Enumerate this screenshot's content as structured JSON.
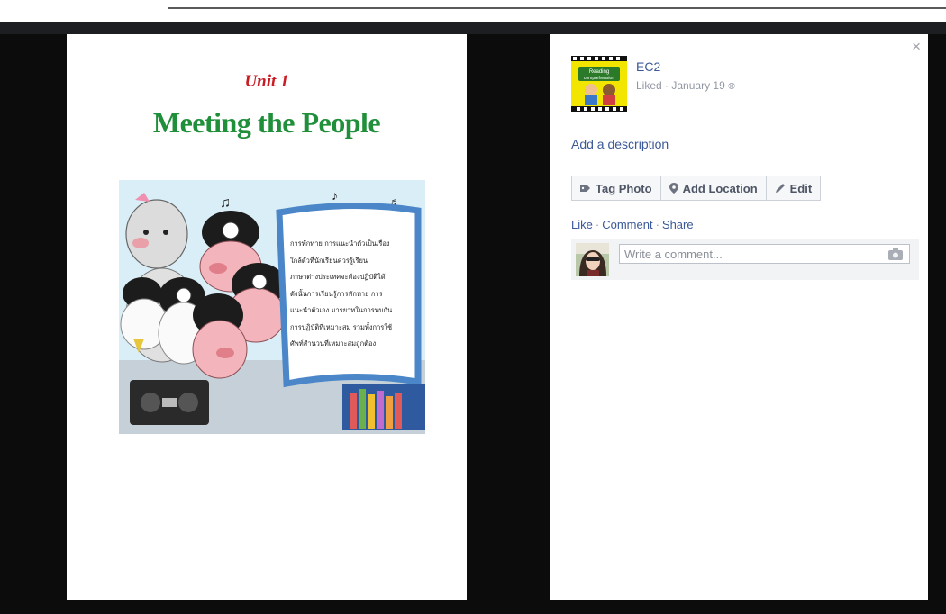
{
  "photo": {
    "unit": "Unit 1",
    "title": "Meeting the People",
    "thai_lines": [
      "การทักทาย การแนะนำตัวเป็นเรื่อง",
      "ใกล้ตัวที่นักเรียนควรรู้เรียน",
      "ภาษาต่างประเทศจะต้องปฏิบัติได้",
      "ดังนั้นการเรียนรู้การทักทาย การ",
      "แนะนำตัวเอง มารยาทในการพบกัน",
      "การปฏิบัติที่เหมาะสม รวมทั้งการใช้",
      "ศัพท์สำนวนที่เหมาะสมถูกต้อง"
    ]
  },
  "sidebar": {
    "avatar_text_1": "Reading",
    "avatar_text_2": "comprehension",
    "page_name": "EC2",
    "liked": "Liked",
    "date": "January 19",
    "add_description": "Add a description",
    "buttons": {
      "tag_photo": "Tag Photo",
      "add_location": "Add Location",
      "edit": "Edit"
    },
    "actions": {
      "like": "Like",
      "comment": "Comment",
      "share": "Share"
    },
    "comment_placeholder": "Write a comment...",
    "close_glyph": "×"
  },
  "colors": {
    "link": "#3b5998",
    "unit_red": "#c81c24",
    "title_green": "#1f8f3a",
    "stage": "#0c0c0c"
  },
  "icons": [
    "close-icon",
    "tag-icon",
    "location-pin-icon",
    "pencil-icon",
    "globe-icon",
    "camera-icon"
  ]
}
